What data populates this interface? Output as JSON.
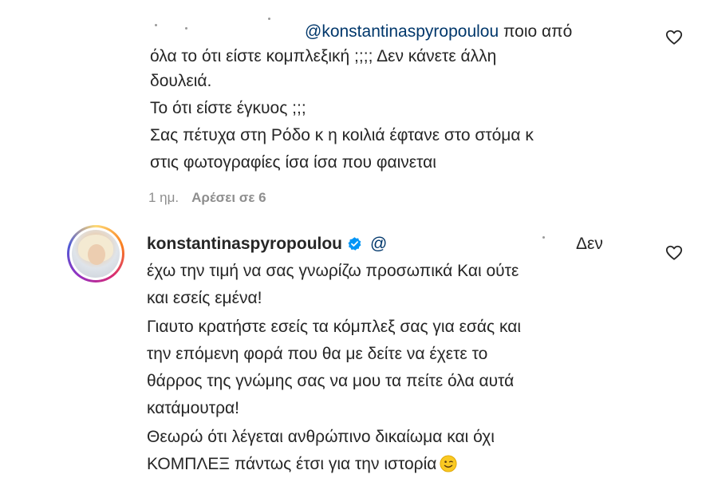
{
  "comment1": {
    "mention": "@konstantinaspyropoulou",
    "text_line1_rest": " ποιο από",
    "lines": [
      "όλα το ότι είστε κομπλεξική ;;;; Δεν κάνετε άλλη",
      "δουλειά.",
      "Το ότι είστε έγκυος ;;;",
      "Σας πέτυχα στη Ρόδο κ η κοιλιά έφτανε στο στόμα κ",
      "στις φωτογραφίες ίσα ίσα που φαινεται"
    ],
    "time": "1 ημ.",
    "likes": "Αρέσει σε 6"
  },
  "comment2": {
    "username": "konstantinaspyropoulou",
    "mention": "@",
    "line1_end": "Δεν",
    "lines": [
      "έχω την τιμή να σας γνωρίζω προσωπικά Και ούτε",
      "και εσείς εμένα!",
      "Γιαυτο κρατήστε εσείς τα κόμπλεξ σας για εσάς και",
      "την επόμενη φορά που θα με δείτε να έχετε το",
      "θάρρος της γνώμης σας να μου τα πείτε όλα αυτά",
      "κατάμουτρα!",
      "Θεωρώ ότι λέγεται ανθρώπινο δικαίωμα και όχι",
      "ΚΟΜΠΛΕΞ πάντως έτσι για την ιστορία"
    ]
  },
  "icons": {
    "heart": "heart-outline-icon",
    "verified": "verified-badge-icon",
    "emoji": "winking-face-emoji"
  },
  "colors": {
    "text": "#262626",
    "mention": "#00376b",
    "meta": "#8e8e8e",
    "verified": "#0095f6"
  }
}
